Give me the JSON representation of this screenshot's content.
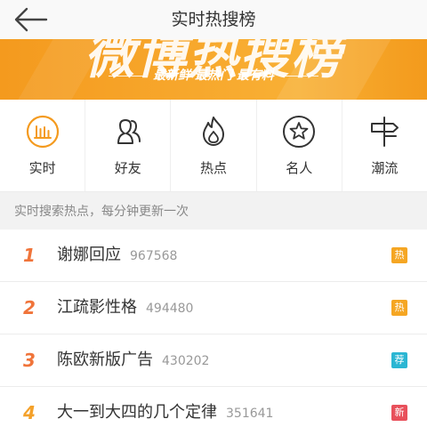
{
  "header": {
    "title": "实时热搜榜"
  },
  "banner": {
    "big_text": "微博热搜榜",
    "tagline": "最新鲜 最热门 最有料"
  },
  "categories": [
    {
      "label": "实时",
      "icon": "realtime-bars-icon"
    },
    {
      "label": "好友",
      "icon": "friends-icon"
    },
    {
      "label": "热点",
      "icon": "flame-icon"
    },
    {
      "label": "名人",
      "icon": "star-icon"
    },
    {
      "label": "潮流",
      "icon": "signpost-icon"
    }
  ],
  "section": {
    "label": "实时搜索热点，每分钟更新一次"
  },
  "list": [
    {
      "rank": "1",
      "title": "谢娜回应",
      "count": "967568",
      "badge": "热",
      "badge_color": "#f5a623"
    },
    {
      "rank": "2",
      "title": "江疏影性格",
      "count": "494480",
      "badge": "热",
      "badge_color": "#f5a623"
    },
    {
      "rank": "3",
      "title": "陈欧新版广告",
      "count": "430202",
      "badge": "荐",
      "badge_color": "#2bb6d3"
    },
    {
      "rank": "4",
      "title": "大一到大四的几个定律",
      "count": "351641",
      "badge": "新",
      "badge_color": "#e8505b"
    }
  ],
  "colors": {
    "accent_orange": "#f49a1e",
    "rank_red": "#f0743a",
    "rank_orange": "#f4a12a"
  }
}
